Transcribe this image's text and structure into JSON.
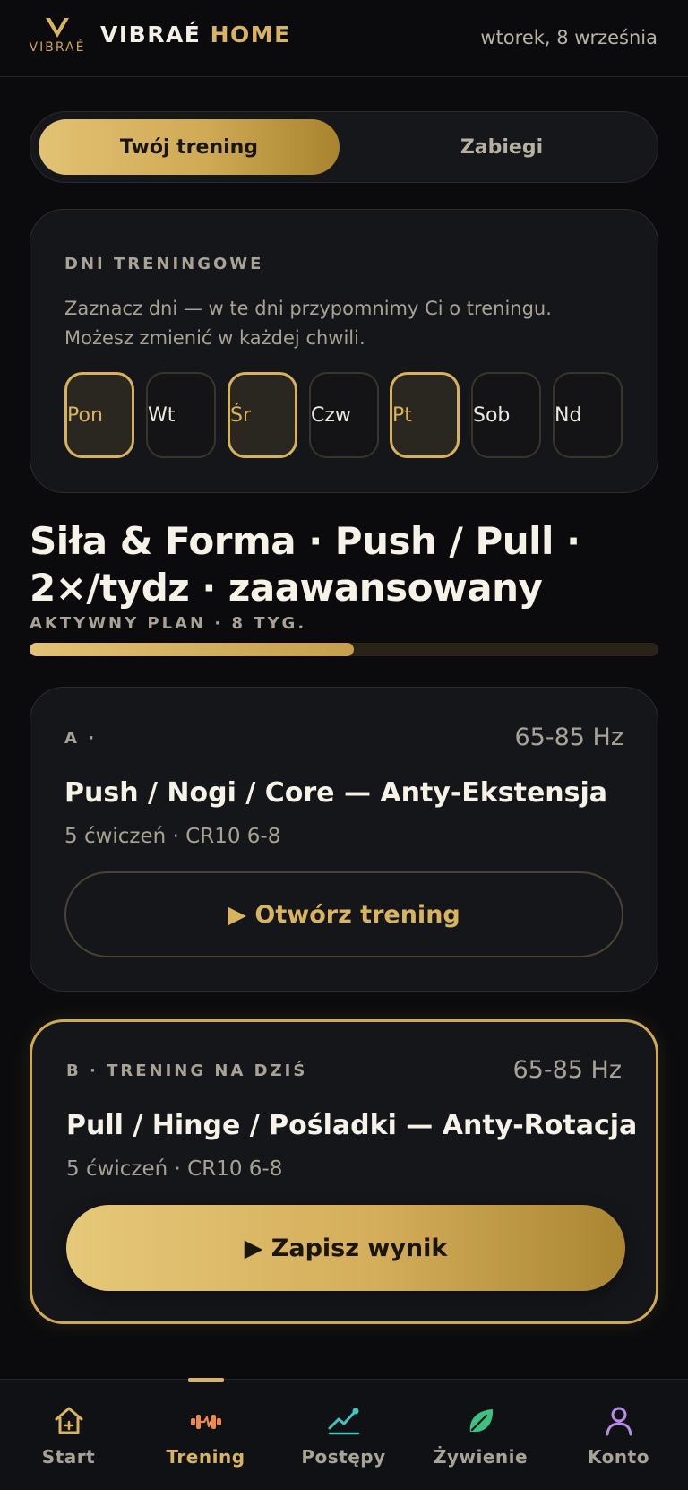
{
  "header": {
    "logo_text": "VIBRAÉ",
    "brand_main": "VIBRAÉ",
    "brand_accent": "HOME",
    "date": "wtorek, 8 września"
  },
  "segment": {
    "active_label": "Twój trening",
    "inactive_label": "Zabiegi"
  },
  "training_days": {
    "title": "DNI TRENINGOWE",
    "description": "Zaznacz dni — w te dni przypomnimy Ci o treningu. Możesz zmienić w każdej chwili.",
    "days": [
      {
        "label": "Pon",
        "selected": true
      },
      {
        "label": "Wt",
        "selected": false
      },
      {
        "label": "Śr",
        "selected": true
      },
      {
        "label": "Czw",
        "selected": false
      },
      {
        "label": "Pt",
        "selected": true
      },
      {
        "label": "Sob",
        "selected": false
      },
      {
        "label": "Nd",
        "selected": false
      }
    ]
  },
  "plan": {
    "title": "Siła & Forma · Push / Pull · 2×/tydz · zaawansowany",
    "subtitle": "AKTYWNY PLAN · 8 TYG.",
    "progress": 0.515
  },
  "workouts": [
    {
      "kicker": "A ·",
      "frequency": "65-85 Hz",
      "title": "Push / Nogi / Core — Anty-Ekstensja",
      "meta": "5 ćwiczeń · CR10 6-8",
      "button": "▶ Otwórz trening"
    },
    {
      "kicker": "B · TRENING NA DZIŚ",
      "frequency": "65-85 Hz",
      "title": "Pull / Hinge / Pośladki — Anty-Rotacja",
      "meta": "5 ćwiczeń · CR10 6-8",
      "button": "▶ Zapisz wynik"
    }
  ],
  "nav": {
    "active": "Trening",
    "items": [
      {
        "label": "Start",
        "icon": "home-icon"
      },
      {
        "label": "Trening",
        "icon": "dumbbell-icon"
      },
      {
        "label": "Postępy",
        "icon": "trend-chart-icon"
      },
      {
        "label": "Żywienie",
        "icon": "leaf-icon"
      },
      {
        "label": "Konto",
        "icon": "user-icon"
      }
    ]
  },
  "colors": {
    "background": "#0b0b0d",
    "card": "#15161a",
    "gold": "#d9b45f",
    "text": "#f6f2e8",
    "muted": "#a9a397"
  }
}
